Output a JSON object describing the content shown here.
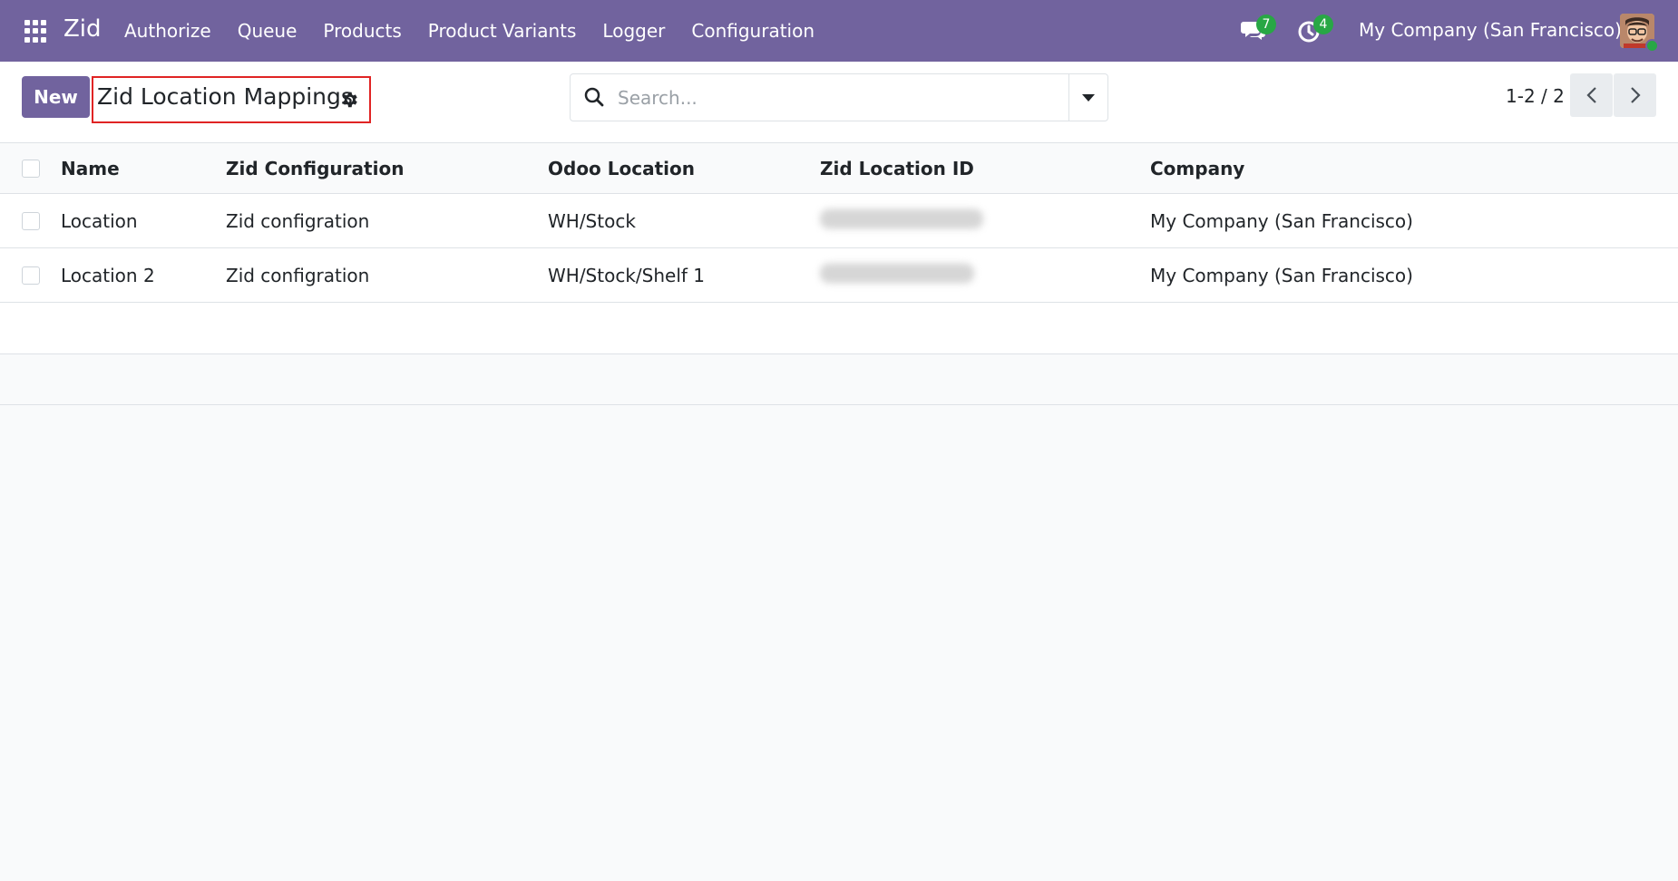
{
  "navbar": {
    "brand": "Zid",
    "menu": [
      "Authorize",
      "Queue",
      "Products",
      "Product Variants",
      "Logger",
      "Configuration"
    ],
    "messages_count": "7",
    "activities_count": "4",
    "company": "My Company (San Francisco)"
  },
  "control_panel": {
    "new_label": "New",
    "title": "Zid Location Mappings",
    "search_placeholder": "Search...",
    "pager": "1-2 / 2"
  },
  "list": {
    "columns": [
      "Name",
      "Zid Configuration",
      "Odoo Location",
      "Zid Location ID",
      "Company"
    ],
    "rows": [
      {
        "name": "Location",
        "zid_configuration": "Zid configration",
        "odoo_location": "WH/Stock",
        "zid_location_id": "",
        "company": "My Company (San Francisco)"
      },
      {
        "name": "Location 2",
        "zid_configuration": "Zid configration",
        "odoo_location": "WH/Stock/Shelf 1",
        "zid_location_id": "",
        "company": "My Company (San Francisco)"
      }
    ]
  },
  "colors": {
    "navbar": "#71639e",
    "primary_button": "#71639e",
    "highlight_border": "#e02424",
    "badge": "#28a745"
  },
  "icons": [
    "apps-grid-icon",
    "chat-icon",
    "activity-clock-icon",
    "avatar",
    "gear-icon",
    "search-icon",
    "caret-down-icon",
    "chevron-left-icon",
    "chevron-right-icon"
  ]
}
